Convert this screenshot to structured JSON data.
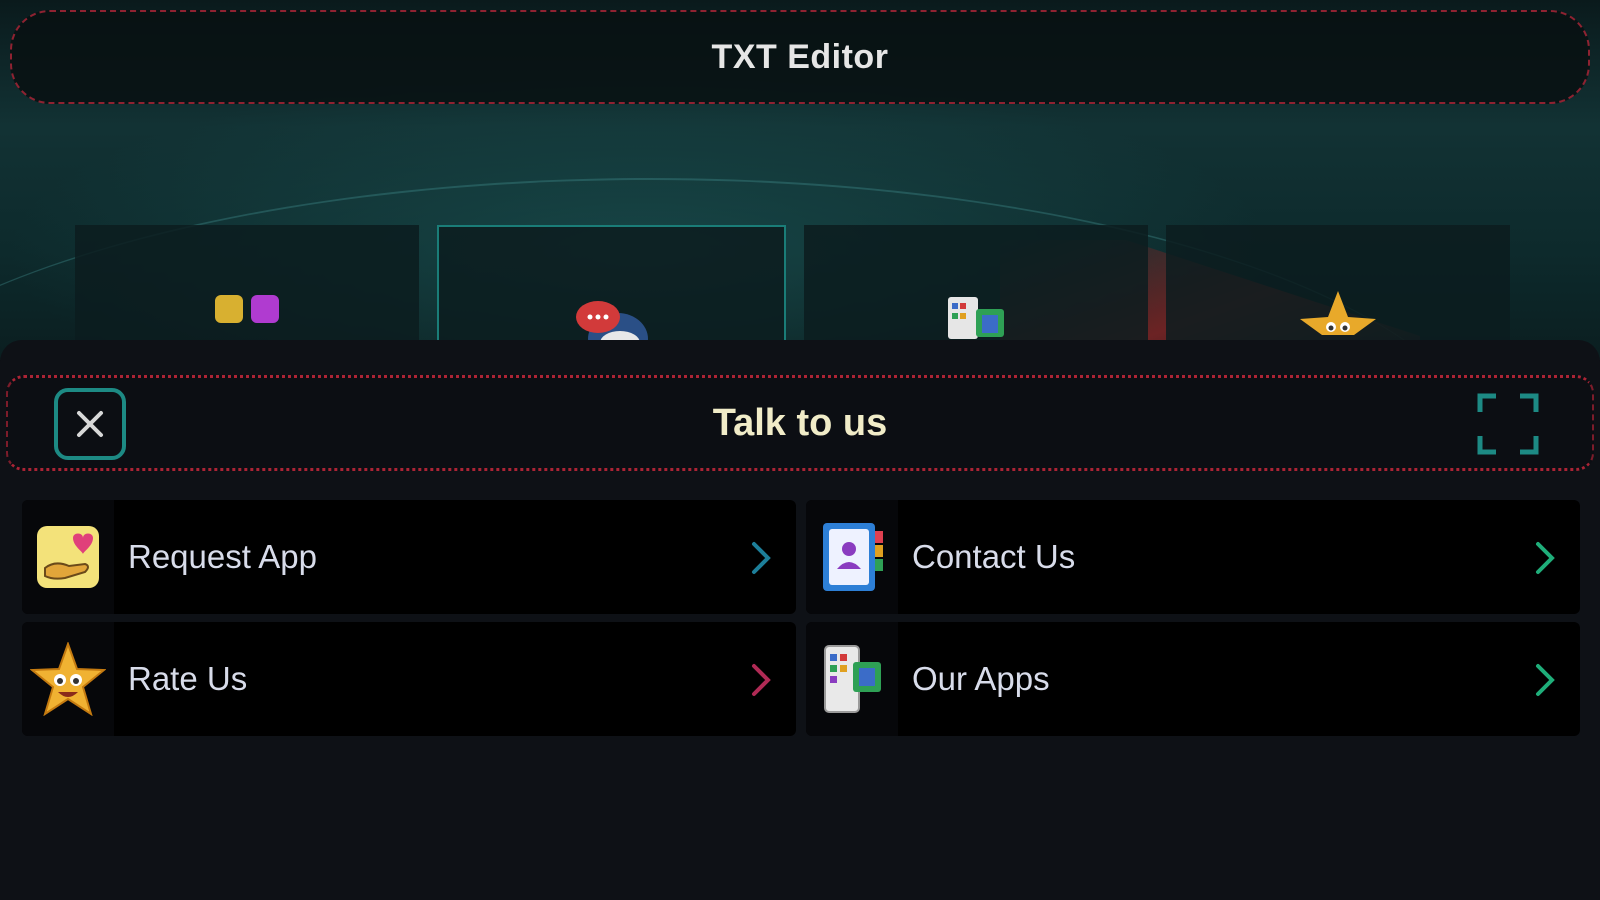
{
  "app": {
    "title": "TXT Editor"
  },
  "sheet": {
    "title": "Talk to us",
    "close_icon": "close-icon",
    "expand_icon": "expand-icon"
  },
  "tiles": [
    {
      "icon": "color-squares-icon",
      "selected": false
    },
    {
      "icon": "chat-bubbles-icon",
      "selected": true
    },
    {
      "icon": "apps-icon",
      "selected": false
    },
    {
      "icon": "star-face-icon",
      "selected": false
    }
  ],
  "menu": {
    "items": [
      {
        "label": "Request App",
        "icon": "request-app-icon",
        "chevron_color": "#1d7f9a"
      },
      {
        "label": "Contact Us",
        "icon": "contact-book-icon",
        "chevron_color": "#1fae7a"
      },
      {
        "label": "Rate Us",
        "icon": "star-face-icon",
        "chevron_color": "#b02a55"
      },
      {
        "label": "Our Apps",
        "icon": "apps-phone-icon",
        "chevron_color": "#1fae7a"
      }
    ]
  },
  "colors": {
    "accent_teal": "#1d8a84",
    "dashed_outline": "#c8283c",
    "sheet_title": "#f1ecc8"
  }
}
